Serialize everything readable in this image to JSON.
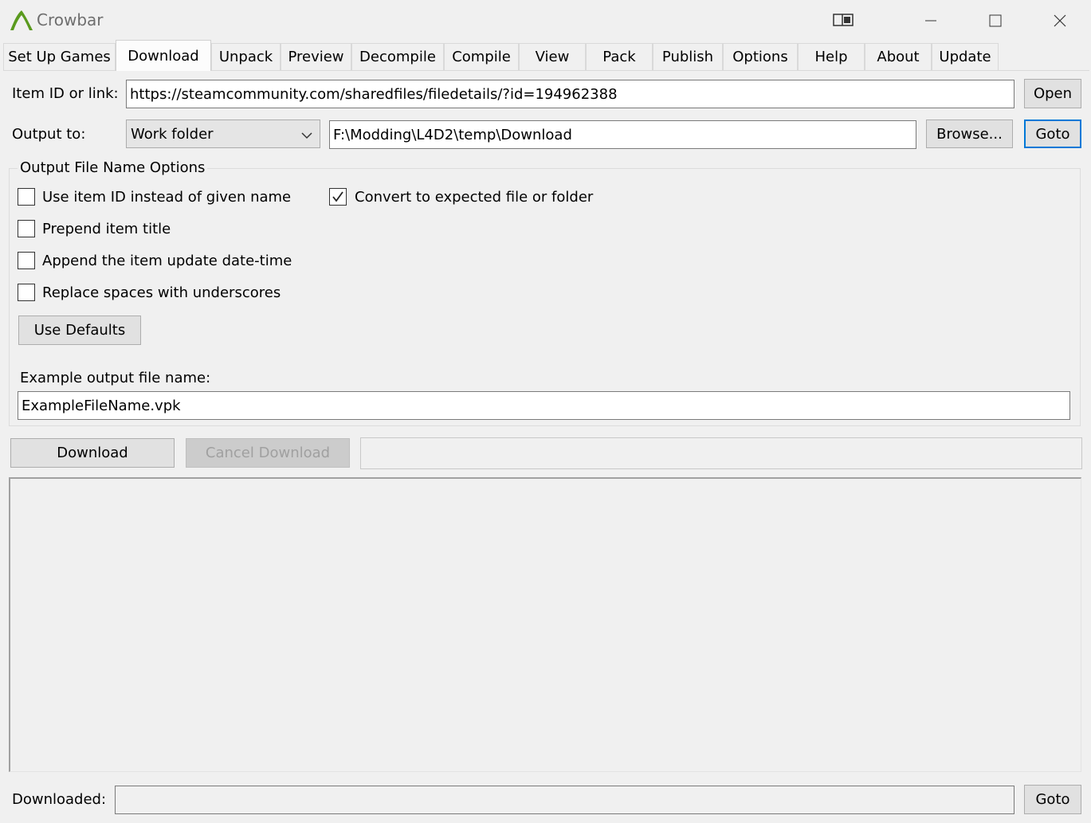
{
  "window": {
    "title": "Crowbar",
    "brand_color": "#5a9a1e"
  },
  "tabs": [
    {
      "label": "Set Up Games"
    },
    {
      "label": "Download"
    },
    {
      "label": "Unpack"
    },
    {
      "label": "Preview"
    },
    {
      "label": "Decompile"
    },
    {
      "label": "Compile"
    },
    {
      "label": "View"
    },
    {
      "label": "Pack"
    },
    {
      "label": "Publish"
    },
    {
      "label": "Options"
    },
    {
      "label": "Help"
    },
    {
      "label": "About"
    },
    {
      "label": "Update"
    }
  ],
  "active_tab": "Download",
  "item": {
    "label": "Item ID or link:",
    "value": "https://steamcommunity.com/sharedfiles/filedetails/?id=194962388",
    "open_label": "Open"
  },
  "output": {
    "label": "Output to:",
    "selected": "Work folder",
    "path": "F:\\Modding\\L4D2\\temp\\Download",
    "browse_label": "Browse...",
    "goto_label": "Goto"
  },
  "options": {
    "title": "Output File Name Options",
    "use_item_id": {
      "label": "Use item ID instead of given name",
      "checked": false
    },
    "prepend_title": {
      "label": "Prepend item title",
      "checked": false
    },
    "append_datetime": {
      "label": "Append the item update date-time",
      "checked": false
    },
    "replace_spaces": {
      "label": "Replace spaces with underscores",
      "checked": false
    },
    "convert_expected": {
      "label": "Convert to expected file or folder",
      "checked": true
    },
    "defaults_label": "Use Defaults",
    "example_label": "Example output file name:",
    "example_value": "ExampleFileName.vpk"
  },
  "actions": {
    "download_label": "Download",
    "cancel_label": "Cancel Download"
  },
  "footer": {
    "downloaded_label": "Downloaded:",
    "downloaded_value": "",
    "goto_label": "Goto"
  },
  "colors": {
    "focus_border": "#0078d7",
    "window_bg": "#f0f0f0"
  }
}
